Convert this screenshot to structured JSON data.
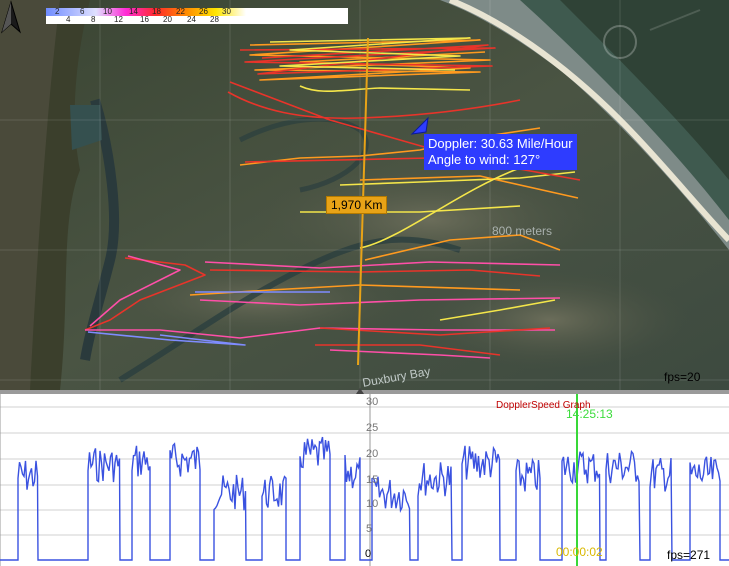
{
  "legend": {
    "top_row": [
      "2",
      "6",
      "10",
      "14",
      "18",
      "22",
      "26",
      "30"
    ],
    "bottom_row": [
      "4",
      "8",
      "12",
      "16",
      "20",
      "24",
      "28"
    ]
  },
  "map": {
    "tooltip": {
      "line1": "Doppler: 30.63 Mile/Hour",
      "line2": "Angle to wind: 127°"
    },
    "distance_label": "1,970 Km",
    "scale_label": "800 meters",
    "bay_label": "Duxbury Bay",
    "fps": "fps=20",
    "colors": {
      "track_red": "#e8342a",
      "track_orange": "#ff9a1f",
      "track_yellow": "#f4e64a",
      "track_pink": "#ff4fa8",
      "track_blue": "#7f8cff",
      "measure_line": "#e8a317"
    }
  },
  "graph": {
    "title": "DopplerSpeed Graph",
    "cursor_time": "14:25:13",
    "start_time": "00:00:02",
    "zero": "0",
    "fps": "fps=271",
    "y_ticks": [
      "30",
      "25",
      "20",
      "15",
      "10",
      "5"
    ],
    "colors": {
      "trace": "#3a52e0",
      "cursor": "#38d838",
      "grid": "#d0d0d0"
    }
  }
}
